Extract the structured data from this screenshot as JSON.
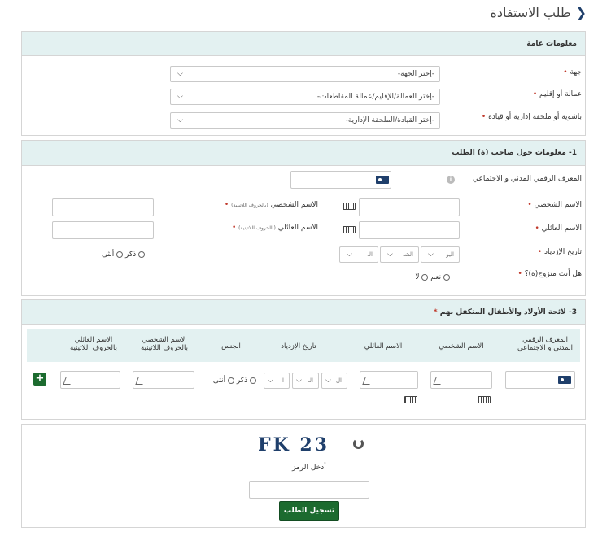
{
  "page": {
    "title": "طلب الاستفادة"
  },
  "general": {
    "heading": "معلومات عامة",
    "jiha_label": "جهة",
    "jiha_value": "-إختر الجهة-",
    "prefecture_label": "عمالة أو إقليم",
    "prefecture_value": "-إختر العمالة/الإقليم/عمالة المقاطعات-",
    "pashalik_label": "باشوية أو ملحقة إدارية أو قيادة",
    "pashalik_value": "-إختر القيادة/الملحقة الإدارية-"
  },
  "applicant": {
    "heading": "1- معلومات حول صاحب (ة) الطلب",
    "id_label": "المعرف الرقمي المدني و الاجتماعي",
    "first_name_label": "الاسم الشخصي",
    "last_name_label": "الاسم العائلي",
    "first_name_latin_label": "الاسم الشخصي",
    "latin_note": "(بالحروف اللاتينية)",
    "last_name_latin_label": "الاسم العائلي",
    "latin_note2": "(بالحروف اللاتينية)",
    "birth_label": "تاريخ الإزدياد",
    "day_placeholder": "اليو",
    "month_placeholder": "الشـ",
    "year_placeholder": "الـ",
    "gender_male": "ذكر",
    "gender_female": "أنثى",
    "married_label": "هل أنت متزوج(ة)؟",
    "married_yes": "نعم",
    "married_no": "لا"
  },
  "children": {
    "heading": "3- لائحة الأولاد والأطفال المتكفل بهم",
    "columns": {
      "id": "المعرف الرقمي المدني و الاجتماعي",
      "first": "الاسم الشخصي",
      "last": "الاسم العائلي",
      "birth": "تاريخ الإزدياد",
      "gender": "الجنس",
      "first_latin": "الاسم الشخصي بالحروف اللاتينية",
      "last_latin": "الاسم العائلي بالحروف اللاتينية"
    },
    "day_ph": "ال",
    "month_ph": "الـ",
    "year_ph": "ا",
    "gender_male": "ذكر",
    "gender_female": "أنثى",
    "add": "+"
  },
  "captcha": {
    "code": "23 FK",
    "label": "أدخل الرمز",
    "submit": "تسجيل الطلب"
  }
}
